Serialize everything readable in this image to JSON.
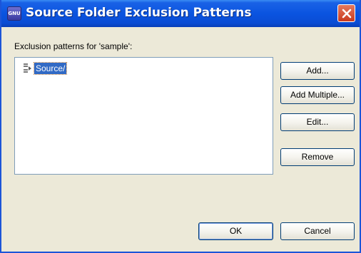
{
  "window": {
    "title": "Source Folder Exclusion Patterns",
    "app_icon_text": "GNU",
    "accent_color": "#0a54e0"
  },
  "dialog": {
    "list_label": "Exclusion patterns for 'sample':",
    "patterns": [
      {
        "label": "Source/",
        "selected": true,
        "icon": "exclusion-pattern-icon"
      }
    ]
  },
  "buttons": {
    "add": "Add...",
    "add_multiple": "Add Multiple...",
    "edit": "Edit...",
    "remove": "Remove",
    "ok": "OK",
    "cancel": "Cancel"
  }
}
